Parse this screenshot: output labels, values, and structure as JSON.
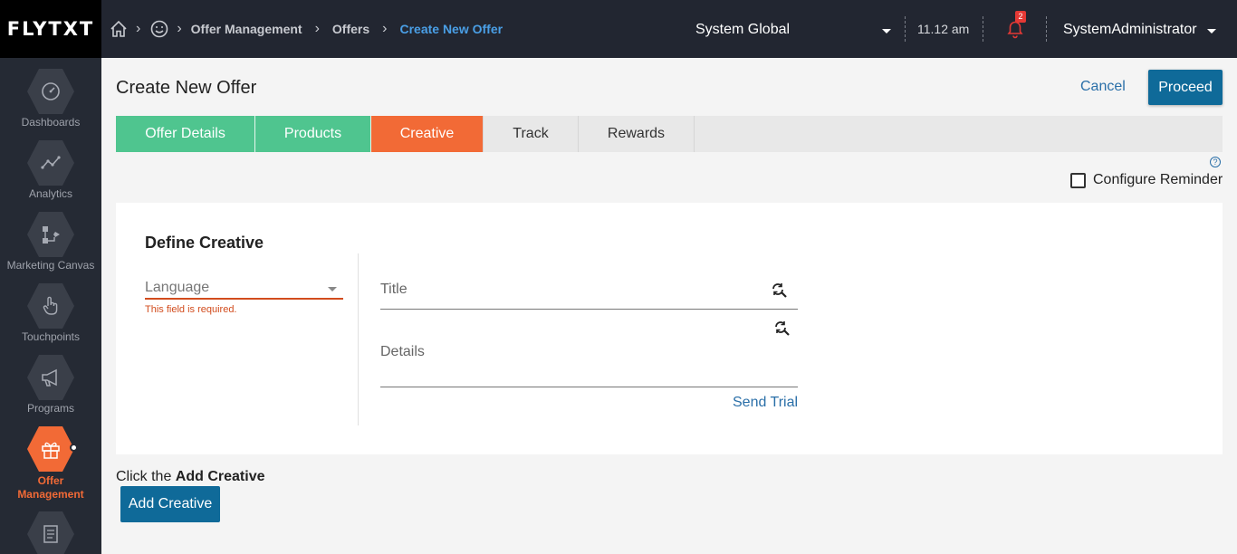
{
  "app": {
    "logo": "FLYTXT"
  },
  "breadcrumb": {
    "items": [
      "Offer Management",
      "Offers",
      "Create New Offer"
    ]
  },
  "header": {
    "context": "System Global",
    "time": "11.12 am",
    "notifications_count": "2",
    "user": "SystemAdministrator"
  },
  "sidebar": {
    "items": [
      {
        "label": "Dashboards",
        "icon": "gauge-icon"
      },
      {
        "label": "Analytics",
        "icon": "analytics-line-icon"
      },
      {
        "label": "Marketing Canvas",
        "icon": "canvas-flow-icon"
      },
      {
        "label": "Touchpoints",
        "icon": "hand-touch-icon"
      },
      {
        "label": "Programs",
        "icon": "megaphone-icon"
      },
      {
        "label": "Offer Management",
        "icon": "gift-icon",
        "active": true
      },
      {
        "label": "",
        "icon": "document-icon"
      }
    ]
  },
  "page": {
    "title": "Create New Offer",
    "cancel_label": "Cancel",
    "proceed_label": "Proceed"
  },
  "tabs": [
    {
      "label": "Offer Details",
      "state": "done"
    },
    {
      "label": "Products",
      "state": "done"
    },
    {
      "label": "Creative",
      "state": "current"
    },
    {
      "label": "Track",
      "state": "pending"
    },
    {
      "label": "Rewards",
      "state": "pending"
    }
  ],
  "reminder": {
    "label": "Configure Reminder",
    "checked": false,
    "help": "?"
  },
  "creative": {
    "title": "Define Creative",
    "language_placeholder": "Language",
    "language_error": "This field is required.",
    "title_label": "Title",
    "details_label": "Details",
    "send_trial_label": "Send Trial"
  },
  "footer": {
    "hint_prefix": "Click the ",
    "hint_bold": "Add Creative",
    "add_button_label": "Add Creative"
  },
  "colors": {
    "topbar": "#222631",
    "sidebar": "#252a34",
    "accent_orange": "#f26a36",
    "tab_done_green": "#4fc58f",
    "primary_blue": "#0f6a99",
    "link_blue": "#2a6fa8",
    "error_red": "#d24c1d"
  }
}
